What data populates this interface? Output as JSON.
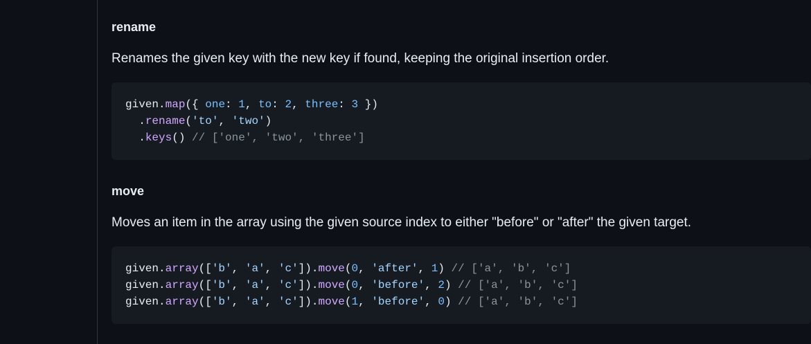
{
  "sections": [
    {
      "heading": "rename",
      "description": "Renames the given key with the new key if found, keeping the original insertion order.",
      "code_lines": [
        [
          {
            "t": "given.",
            "c": "plain"
          },
          {
            "t": "map",
            "c": "fn"
          },
          {
            "t": "({ ",
            "c": "plain"
          },
          {
            "t": "one",
            "c": "prop"
          },
          {
            "t": ": ",
            "c": "plain"
          },
          {
            "t": "1",
            "c": "num"
          },
          {
            "t": ", ",
            "c": "plain"
          },
          {
            "t": "to",
            "c": "prop"
          },
          {
            "t": ": ",
            "c": "plain"
          },
          {
            "t": "2",
            "c": "num"
          },
          {
            "t": ", ",
            "c": "plain"
          },
          {
            "t": "three",
            "c": "prop"
          },
          {
            "t": ": ",
            "c": "plain"
          },
          {
            "t": "3",
            "c": "num"
          },
          {
            "t": " })",
            "c": "plain"
          }
        ],
        [
          {
            "t": "  .",
            "c": "plain"
          },
          {
            "t": "rename",
            "c": "fn"
          },
          {
            "t": "(",
            "c": "plain"
          },
          {
            "t": "'to'",
            "c": "str"
          },
          {
            "t": ", ",
            "c": "plain"
          },
          {
            "t": "'two'",
            "c": "str"
          },
          {
            "t": ")",
            "c": "plain"
          }
        ],
        [
          {
            "t": "  .",
            "c": "plain"
          },
          {
            "t": "keys",
            "c": "fn"
          },
          {
            "t": "() ",
            "c": "plain"
          },
          {
            "t": "// ['one', 'two', 'three']",
            "c": "cmt"
          }
        ]
      ]
    },
    {
      "heading": "move",
      "description": "Moves an item in the array using the given source index to either \"before\" or \"after\" the given target.",
      "code_lines": [
        [
          {
            "t": "given.",
            "c": "plain"
          },
          {
            "t": "array",
            "c": "fn"
          },
          {
            "t": "([",
            "c": "plain"
          },
          {
            "t": "'b'",
            "c": "str"
          },
          {
            "t": ", ",
            "c": "plain"
          },
          {
            "t": "'a'",
            "c": "str"
          },
          {
            "t": ", ",
            "c": "plain"
          },
          {
            "t": "'c'",
            "c": "str"
          },
          {
            "t": "]).",
            "c": "plain"
          },
          {
            "t": "move",
            "c": "fn"
          },
          {
            "t": "(",
            "c": "plain"
          },
          {
            "t": "0",
            "c": "num"
          },
          {
            "t": ", ",
            "c": "plain"
          },
          {
            "t": "'after'",
            "c": "str"
          },
          {
            "t": ", ",
            "c": "plain"
          },
          {
            "t": "1",
            "c": "num"
          },
          {
            "t": ") ",
            "c": "plain"
          },
          {
            "t": "// ['a', 'b', 'c']",
            "c": "cmt"
          }
        ],
        [
          {
            "t": "given.",
            "c": "plain"
          },
          {
            "t": "array",
            "c": "fn"
          },
          {
            "t": "([",
            "c": "plain"
          },
          {
            "t": "'b'",
            "c": "str"
          },
          {
            "t": ", ",
            "c": "plain"
          },
          {
            "t": "'a'",
            "c": "str"
          },
          {
            "t": ", ",
            "c": "plain"
          },
          {
            "t": "'c'",
            "c": "str"
          },
          {
            "t": "]).",
            "c": "plain"
          },
          {
            "t": "move",
            "c": "fn"
          },
          {
            "t": "(",
            "c": "plain"
          },
          {
            "t": "0",
            "c": "num"
          },
          {
            "t": ", ",
            "c": "plain"
          },
          {
            "t": "'before'",
            "c": "str"
          },
          {
            "t": ", ",
            "c": "plain"
          },
          {
            "t": "2",
            "c": "num"
          },
          {
            "t": ") ",
            "c": "plain"
          },
          {
            "t": "// ['a', 'b', 'c']",
            "c": "cmt"
          }
        ],
        [
          {
            "t": "given.",
            "c": "plain"
          },
          {
            "t": "array",
            "c": "fn"
          },
          {
            "t": "([",
            "c": "plain"
          },
          {
            "t": "'b'",
            "c": "str"
          },
          {
            "t": ", ",
            "c": "plain"
          },
          {
            "t": "'a'",
            "c": "str"
          },
          {
            "t": ", ",
            "c": "plain"
          },
          {
            "t": "'c'",
            "c": "str"
          },
          {
            "t": "]).",
            "c": "plain"
          },
          {
            "t": "move",
            "c": "fn"
          },
          {
            "t": "(",
            "c": "plain"
          },
          {
            "t": "1",
            "c": "num"
          },
          {
            "t": ", ",
            "c": "plain"
          },
          {
            "t": "'before'",
            "c": "str"
          },
          {
            "t": ", ",
            "c": "plain"
          },
          {
            "t": "0",
            "c": "num"
          },
          {
            "t": ") ",
            "c": "plain"
          },
          {
            "t": "// ['a', 'b', 'c']",
            "c": "cmt"
          }
        ]
      ]
    }
  ],
  "colors": {
    "background": "#0d1117",
    "code_background": "#161b22",
    "text": "#e6edf3",
    "function": "#d2a8ff",
    "property_number": "#79c0ff",
    "string": "#a5d6ff",
    "comment": "#8b949e"
  }
}
